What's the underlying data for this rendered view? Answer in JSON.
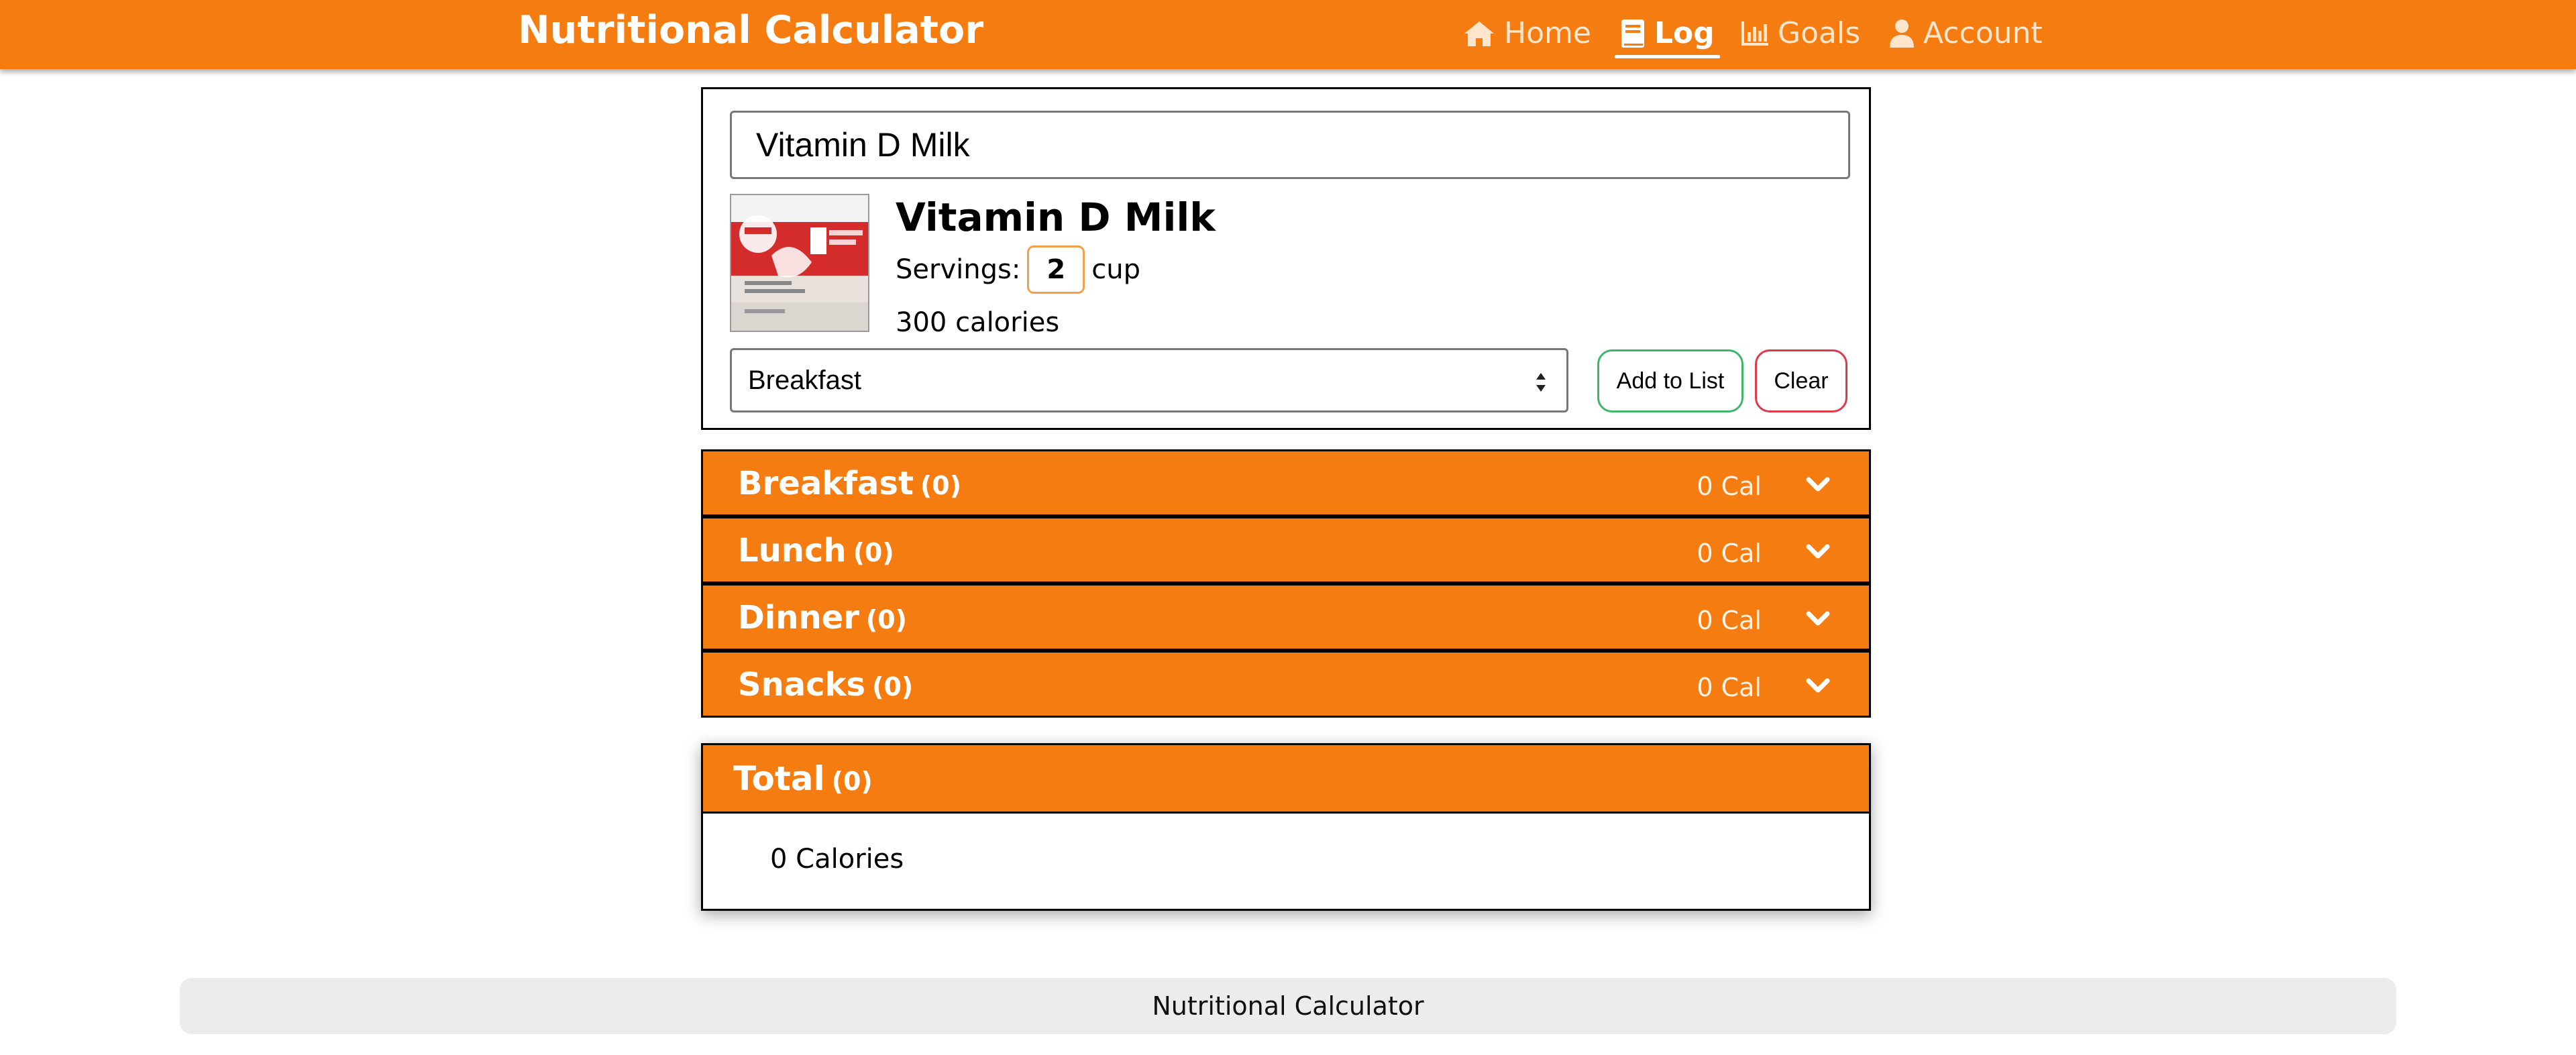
{
  "app": {
    "title": "Nutritional Calculator"
  },
  "nav": {
    "items": [
      {
        "label": "Home",
        "icon": "home-icon",
        "active": false
      },
      {
        "label": "Log",
        "icon": "book-icon",
        "active": true
      },
      {
        "label": "Goals",
        "icon": "bar-chart-icon",
        "active": false
      },
      {
        "label": "Account",
        "icon": "user-icon",
        "active": false
      }
    ]
  },
  "entry": {
    "search_value": "Vitamin D Milk",
    "food_name": "Vitamin D Milk",
    "servings_label": "Servings:",
    "servings_value": "2",
    "servings_unit": "cup",
    "calories": "300 calories",
    "meal_selected": "Breakfast",
    "meal_options": [
      "Breakfast",
      "Lunch",
      "Dinner",
      "Snacks"
    ],
    "add_label": "Add to List",
    "clear_label": "Clear"
  },
  "meals": [
    {
      "name": "Breakfast",
      "count": "(0)",
      "calories": "0 Cal"
    },
    {
      "name": "Lunch",
      "count": "(0)",
      "calories": "0 Cal"
    },
    {
      "name": "Dinner",
      "count": "(0)",
      "calories": "0 Cal"
    },
    {
      "name": "Snacks",
      "count": "(0)",
      "calories": "0 Cal"
    }
  ],
  "total": {
    "title": "Total",
    "count": "(0)",
    "calories": "0 Calories"
  },
  "footer": {
    "text": "Nutritional Calculator"
  },
  "colors": {
    "brand_orange": "#f57c11",
    "add_green": "#3fb46a",
    "clear_red": "#dc3a4c"
  }
}
